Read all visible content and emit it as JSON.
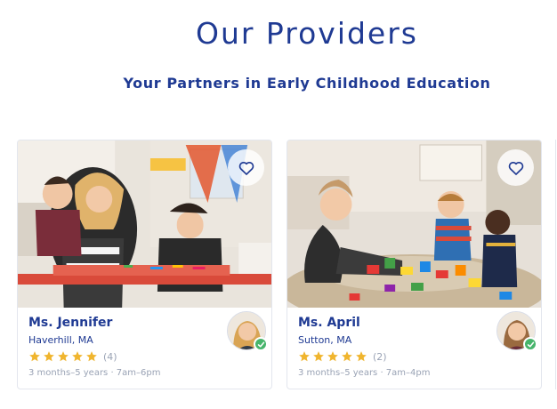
{
  "header": {
    "title": "Our Providers",
    "subtitle": "Your Partners in Early Childhood Education"
  },
  "colors": {
    "brand": "#1f3a93",
    "muted": "#9aa3b5",
    "star": "#f0b52e",
    "verified": "#47b46b"
  },
  "providers": [
    {
      "name": "Ms. Jennifer",
      "location": "Haverhill, MA",
      "rating": 5,
      "review_count": "(4)",
      "meta": "3 months–5 years · 7am–6pm",
      "icons": {
        "favorite": "heart-outline-icon",
        "verified": "check-badge-icon"
      }
    },
    {
      "name": "Ms. April",
      "location": "Sutton, MA",
      "rating": 5,
      "review_count": "(2)",
      "meta": "3 months–5 years · 7am–4pm",
      "icons": {
        "favorite": "heart-outline-icon",
        "verified": "check-badge-icon"
      }
    }
  ]
}
